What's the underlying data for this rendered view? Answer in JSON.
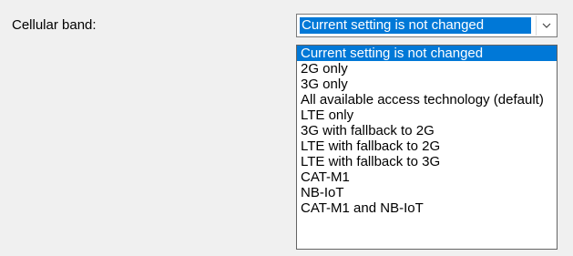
{
  "field": {
    "label": "Cellular band:"
  },
  "select": {
    "value": "Current setting is not changed",
    "options": [
      "Current setting is not changed",
      "2G only",
      "3G only",
      "All available access technology (default)",
      "LTE only",
      "3G with fallback to 2G",
      "LTE with fallback to 2G",
      "LTE with fallback to 3G",
      "CAT-M1",
      "NB-IoT",
      "CAT-M1 and NB-IoT"
    ],
    "selected_index": 0,
    "dropdown_icon": "chevron-down-icon"
  },
  "colors": {
    "window_background": "#f0f0f0",
    "selection_highlight": "#0078d7",
    "selection_text": "#ffffff",
    "dropdown_border": "#646464"
  }
}
